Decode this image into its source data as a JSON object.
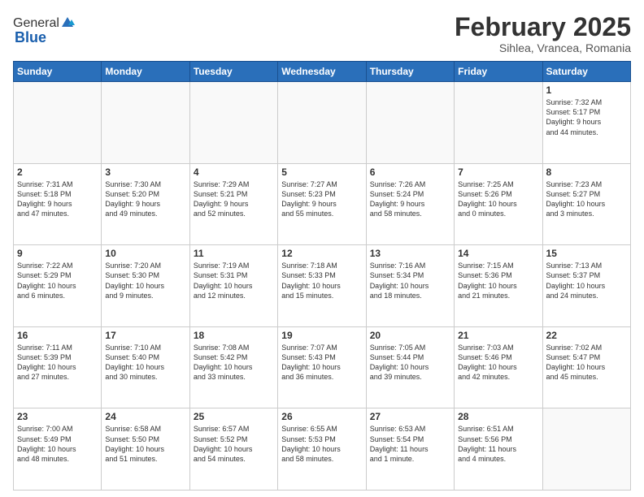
{
  "header": {
    "logo_general": "General",
    "logo_blue": "Blue",
    "title": "February 2025",
    "subtitle": "Sihlea, Vrancea, Romania"
  },
  "calendar": {
    "days_of_week": [
      "Sunday",
      "Monday",
      "Tuesday",
      "Wednesday",
      "Thursday",
      "Friday",
      "Saturday"
    ],
    "weeks": [
      [
        {
          "day": "",
          "info": ""
        },
        {
          "day": "",
          "info": ""
        },
        {
          "day": "",
          "info": ""
        },
        {
          "day": "",
          "info": ""
        },
        {
          "day": "",
          "info": ""
        },
        {
          "day": "",
          "info": ""
        },
        {
          "day": "1",
          "info": "Sunrise: 7:32 AM\nSunset: 5:17 PM\nDaylight: 9 hours\nand 44 minutes."
        }
      ],
      [
        {
          "day": "2",
          "info": "Sunrise: 7:31 AM\nSunset: 5:18 PM\nDaylight: 9 hours\nand 47 minutes."
        },
        {
          "day": "3",
          "info": "Sunrise: 7:30 AM\nSunset: 5:20 PM\nDaylight: 9 hours\nand 49 minutes."
        },
        {
          "day": "4",
          "info": "Sunrise: 7:29 AM\nSunset: 5:21 PM\nDaylight: 9 hours\nand 52 minutes."
        },
        {
          "day": "5",
          "info": "Sunrise: 7:27 AM\nSunset: 5:23 PM\nDaylight: 9 hours\nand 55 minutes."
        },
        {
          "day": "6",
          "info": "Sunrise: 7:26 AM\nSunset: 5:24 PM\nDaylight: 9 hours\nand 58 minutes."
        },
        {
          "day": "7",
          "info": "Sunrise: 7:25 AM\nSunset: 5:26 PM\nDaylight: 10 hours\nand 0 minutes."
        },
        {
          "day": "8",
          "info": "Sunrise: 7:23 AM\nSunset: 5:27 PM\nDaylight: 10 hours\nand 3 minutes."
        }
      ],
      [
        {
          "day": "9",
          "info": "Sunrise: 7:22 AM\nSunset: 5:29 PM\nDaylight: 10 hours\nand 6 minutes."
        },
        {
          "day": "10",
          "info": "Sunrise: 7:20 AM\nSunset: 5:30 PM\nDaylight: 10 hours\nand 9 minutes."
        },
        {
          "day": "11",
          "info": "Sunrise: 7:19 AM\nSunset: 5:31 PM\nDaylight: 10 hours\nand 12 minutes."
        },
        {
          "day": "12",
          "info": "Sunrise: 7:18 AM\nSunset: 5:33 PM\nDaylight: 10 hours\nand 15 minutes."
        },
        {
          "day": "13",
          "info": "Sunrise: 7:16 AM\nSunset: 5:34 PM\nDaylight: 10 hours\nand 18 minutes."
        },
        {
          "day": "14",
          "info": "Sunrise: 7:15 AM\nSunset: 5:36 PM\nDaylight: 10 hours\nand 21 minutes."
        },
        {
          "day": "15",
          "info": "Sunrise: 7:13 AM\nSunset: 5:37 PM\nDaylight: 10 hours\nand 24 minutes."
        }
      ],
      [
        {
          "day": "16",
          "info": "Sunrise: 7:11 AM\nSunset: 5:39 PM\nDaylight: 10 hours\nand 27 minutes."
        },
        {
          "day": "17",
          "info": "Sunrise: 7:10 AM\nSunset: 5:40 PM\nDaylight: 10 hours\nand 30 minutes."
        },
        {
          "day": "18",
          "info": "Sunrise: 7:08 AM\nSunset: 5:42 PM\nDaylight: 10 hours\nand 33 minutes."
        },
        {
          "day": "19",
          "info": "Sunrise: 7:07 AM\nSunset: 5:43 PM\nDaylight: 10 hours\nand 36 minutes."
        },
        {
          "day": "20",
          "info": "Sunrise: 7:05 AM\nSunset: 5:44 PM\nDaylight: 10 hours\nand 39 minutes."
        },
        {
          "day": "21",
          "info": "Sunrise: 7:03 AM\nSunset: 5:46 PM\nDaylight: 10 hours\nand 42 minutes."
        },
        {
          "day": "22",
          "info": "Sunrise: 7:02 AM\nSunset: 5:47 PM\nDaylight: 10 hours\nand 45 minutes."
        }
      ],
      [
        {
          "day": "23",
          "info": "Sunrise: 7:00 AM\nSunset: 5:49 PM\nDaylight: 10 hours\nand 48 minutes."
        },
        {
          "day": "24",
          "info": "Sunrise: 6:58 AM\nSunset: 5:50 PM\nDaylight: 10 hours\nand 51 minutes."
        },
        {
          "day": "25",
          "info": "Sunrise: 6:57 AM\nSunset: 5:52 PM\nDaylight: 10 hours\nand 54 minutes."
        },
        {
          "day": "26",
          "info": "Sunrise: 6:55 AM\nSunset: 5:53 PM\nDaylight: 10 hours\nand 58 minutes."
        },
        {
          "day": "27",
          "info": "Sunrise: 6:53 AM\nSunset: 5:54 PM\nDaylight: 11 hours\nand 1 minute."
        },
        {
          "day": "28",
          "info": "Sunrise: 6:51 AM\nSunset: 5:56 PM\nDaylight: 11 hours\nand 4 minutes."
        },
        {
          "day": "",
          "info": ""
        }
      ]
    ]
  }
}
